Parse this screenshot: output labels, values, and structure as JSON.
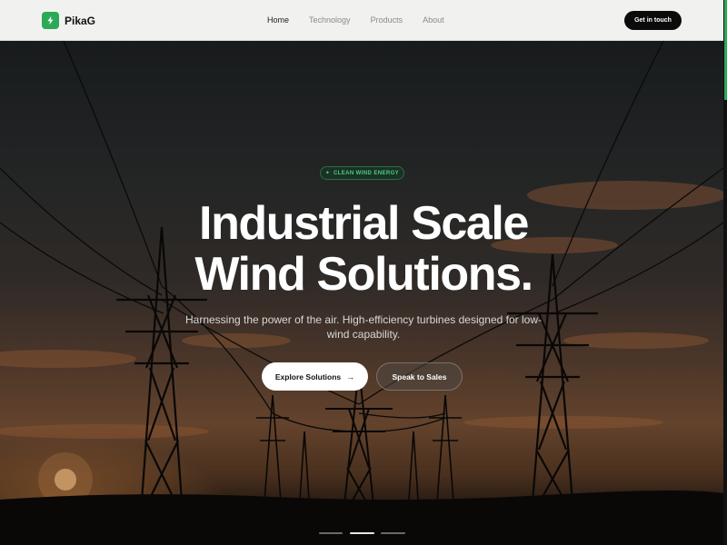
{
  "nav": {
    "brand": "PikaG",
    "brand_icon": "lightning-icon",
    "links": [
      {
        "label": "Home",
        "active": true
      },
      {
        "label": "Technology",
        "active": false
      },
      {
        "label": "Products",
        "active": false
      },
      {
        "label": "About",
        "active": false
      }
    ],
    "cta_label": "Get in touch"
  },
  "hero": {
    "badge_icon": "sparkle-icon",
    "badge": "CLEAN WIND ENERGY",
    "headline_line1": "Industrial Scale",
    "headline_line2": "Wind Solutions.",
    "subtitle": "Harnessing the power of the air. High-efficiency turbines designed for low-wind capability.",
    "primary_button": "Explore Solutions",
    "primary_button_icon": "arrow-right-icon",
    "secondary_button": "Speak to Sales",
    "carousel_active_index": 2,
    "carousel_slide_count": 3
  },
  "colors": {
    "accent": "#2aa957",
    "badge_text": "#4bd07e",
    "nav_background": "#f1f1f0",
    "cta_background": "#0b0b0b"
  }
}
